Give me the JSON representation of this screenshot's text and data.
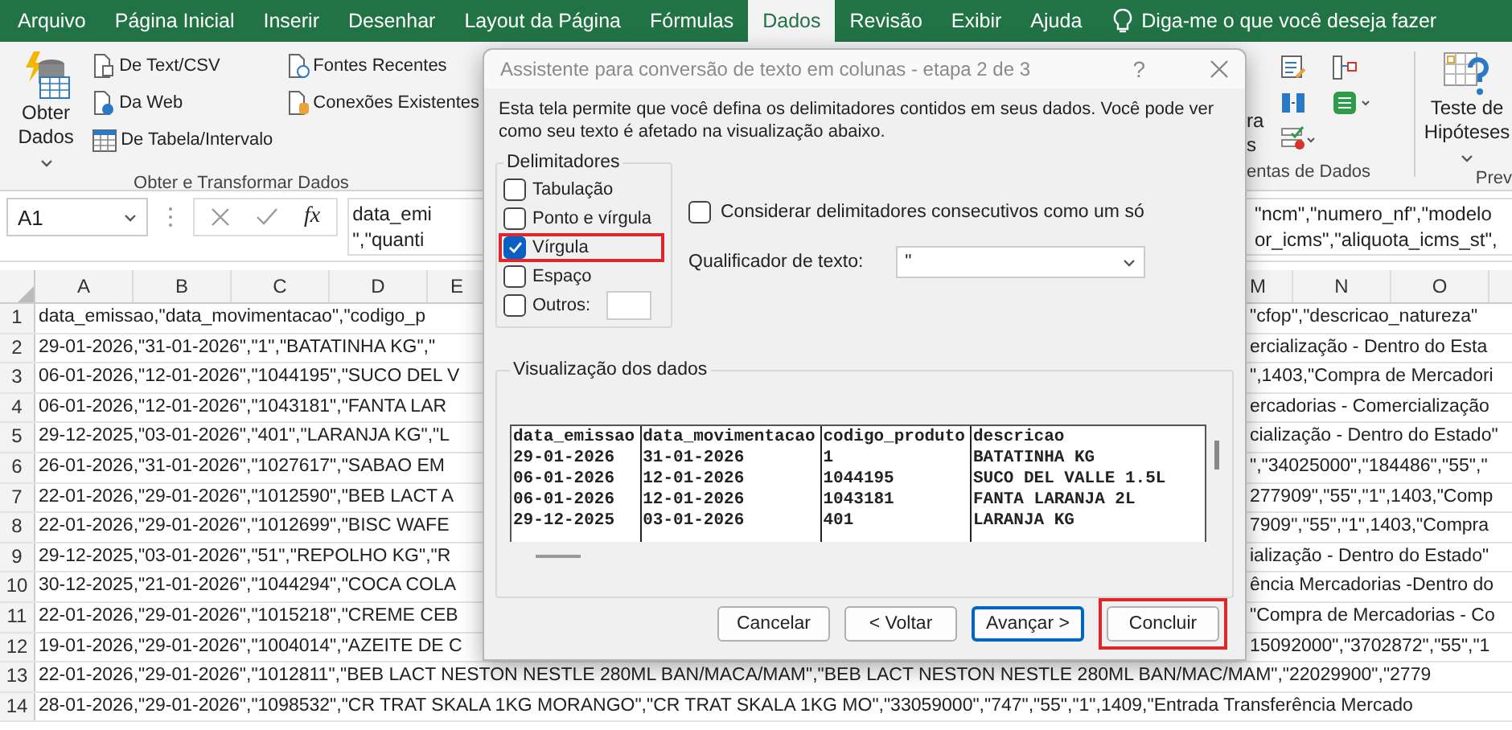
{
  "ribbon": {
    "tabs": [
      {
        "label": "Arquivo",
        "selected": false
      },
      {
        "label": "Página Inicial",
        "selected": false
      },
      {
        "label": "Inserir",
        "selected": false
      },
      {
        "label": "Desenhar",
        "selected": false
      },
      {
        "label": "Layout da Página",
        "selected": false
      },
      {
        "label": "Fórmulas",
        "selected": false
      },
      {
        "label": "Dados",
        "selected": true
      },
      {
        "label": "Revisão",
        "selected": false
      },
      {
        "label": "Exibir",
        "selected": false
      },
      {
        "label": "Ajuda",
        "selected": false
      }
    ],
    "tell_me": "Diga-me o que você deseja fazer",
    "get_data": {
      "big_button": [
        "Obter",
        "Dados"
      ],
      "buttons": [
        "De Text/CSV",
        "Da Web",
        "De Tabela/Intervalo"
      ],
      "buttons_2": [
        "Fontes Recentes",
        "Conexões Existentes"
      ],
      "group_label": "Obter e Transformar Dados"
    },
    "data_tools": {
      "fragments": [
        "ra",
        "s"
      ],
      "group_label": "entas de Dados"
    },
    "what_if": [
      "Teste de",
      "Hipóteses"
    ],
    "forecast_label": "Prev"
  },
  "formula_bar": {
    "name_box": "A1",
    "fx": "fx",
    "left_lines": [
      "data_emi",
      "\",\"quanti"
    ],
    "right_lines": [
      "\"ncm\",\"numero_nf\",\"modelo",
      "or_icms\",\"aliquota_icms_st\","
    ]
  },
  "sheet": {
    "columns_left": [
      "A",
      "B",
      "C",
      "D",
      "E"
    ],
    "columns_right": [
      "M",
      "N",
      "O"
    ],
    "rows": [
      {
        "number": "1",
        "left": "data_emissao,\"data_movimentacao\",\"codigo_p",
        "right": "\"cfop\",\"descricao_natureza\""
      },
      {
        "number": "2",
        "left": "29-01-2026,\"31-01-2026\",\"1\",\"BATATINHA KG\",\"",
        "right": "ercialização - Dentro do Esta"
      },
      {
        "number": "3",
        "left": "06-01-2026,\"12-01-2026\",\"1044195\",\"SUCO DEL V",
        "right": "\",1403,\"Compra de Mercadori"
      },
      {
        "number": "4",
        "left": "06-01-2026,\"12-01-2026\",\"1043181\",\"FANTA LAR",
        "right": "ercadorias - Comercialização"
      },
      {
        "number": "5",
        "left": "29-12-2025,\"03-01-2026\",\"401\",\"LARANJA KG\",\"L",
        "right": "cialização - Dentro do Estado\""
      },
      {
        "number": "6",
        "left": "26-01-2026,\"31-01-2026\",\"1027617\",\"SABAO EM",
        "right": "\",\"34025000\",\"184486\",\"55\",\""
      },
      {
        "number": "7",
        "left": "22-01-2026,\"29-01-2026\",\"1012590\",\"BEB LACT A",
        "right": "277909\",\"55\",\"1\",1403,\"Comp"
      },
      {
        "number": "8",
        "left": "22-01-2026,\"29-01-2026\",\"1012699\",\"BISC WAFE",
        "right": "7909\",\"55\",\"1\",1403,\"Compra"
      },
      {
        "number": "9",
        "left": "29-12-2025,\"03-01-2026\",\"51\",\"REPOLHO KG\",\"R",
        "right": "ialização - Dentro do Estado\""
      },
      {
        "number": "10",
        "left": "30-12-2025,\"21-01-2026\",\"1044294\",\"COCA COLA",
        "right": "ência Mercadorias -Dentro do"
      },
      {
        "number": "11",
        "left": "22-01-2026,\"29-01-2026\",\"1015218\",\"CREME CEB",
        "right": "\"Compra de Mercadorias - Co"
      },
      {
        "number": "12",
        "left": "19-01-2026,\"29-01-2026\",\"1004014\",\"AZEITE DE C",
        "right": "15092000\",\"3702872\",\"55\",\"1"
      },
      {
        "number": "13",
        "text": "22-01-2026,\"29-01-2026\",\"1012811\",\"BEB LACT NESTON NESTLE 280ML BAN/MACA/MAM\",\"BEB LACT NESTON NESTLE 280ML BAN/MAC/MAM\",\"22029900\",\"2779"
      },
      {
        "number": "14",
        "text": "28-01-2026,\"29-01-2026\",\"1098532\",\"CR TRAT SKALA 1KG MORANGO\",\"CR TRAT SKALA 1KG MO\",\"33059000\",\"747\",\"55\",\"1\",1409,\"Entrada Transferência Mercado"
      }
    ]
  },
  "dialog": {
    "title": "Assistente para conversão de texto em colunas - etapa 2 de 3",
    "help": "?",
    "description": "Esta tela permite que você defina os delimitadores contidos em seus dados. Você pode ver como seu texto é afetado na visualização abaixo.",
    "delimiters": {
      "legend": "Delimitadores",
      "options": [
        {
          "label": "Tabulação",
          "checked": false,
          "highlighted": false,
          "kind": "plain"
        },
        {
          "label": "Ponto e vírgula",
          "checked": false,
          "highlighted": false,
          "kind": "plain"
        },
        {
          "label": "Vírgula",
          "checked": true,
          "highlighted": true,
          "kind": "plain"
        },
        {
          "label": "Espaço",
          "checked": false,
          "highlighted": false,
          "kind": "plain"
        },
        {
          "label": "Outros:",
          "checked": false,
          "highlighted": false,
          "kind": "with_field"
        }
      ]
    },
    "consecutive": {
      "label": "Considerar delimitadores consecutivos como um só",
      "checked": false
    },
    "qualifier": {
      "label": "Qualificador de texto:",
      "value": "\""
    },
    "preview": {
      "legend": "Visualização dos dados",
      "columns": [
        {
          "header": "data_emissao",
          "cells": [
            "29-01-2026",
            "06-01-2026",
            "06-01-2026",
            "29-12-2025"
          ]
        },
        {
          "header": "data_movimentacao",
          "cells": [
            "31-01-2026",
            "12-01-2026",
            "12-01-2026",
            "03-01-2026"
          ]
        },
        {
          "header": "codigo_produto",
          "cells": [
            "1",
            "1044195",
            "1043181",
            "401"
          ]
        },
        {
          "header": "descricao",
          "cells": [
            "BATATINHA KG",
            "SUCO DEL VALLE 1.5L",
            "FANTA LARANJA 2L",
            "LARANJA KG"
          ]
        }
      ]
    },
    "buttons": [
      {
        "label": "Cancelar",
        "focused": false,
        "highlighted": false
      },
      {
        "label": "< Voltar",
        "focused": false,
        "highlighted": false
      },
      {
        "label": "Avançar >",
        "focused": true,
        "highlighted": false
      },
      {
        "label": "Concluir",
        "focused": false,
        "highlighted": true
      }
    ]
  }
}
